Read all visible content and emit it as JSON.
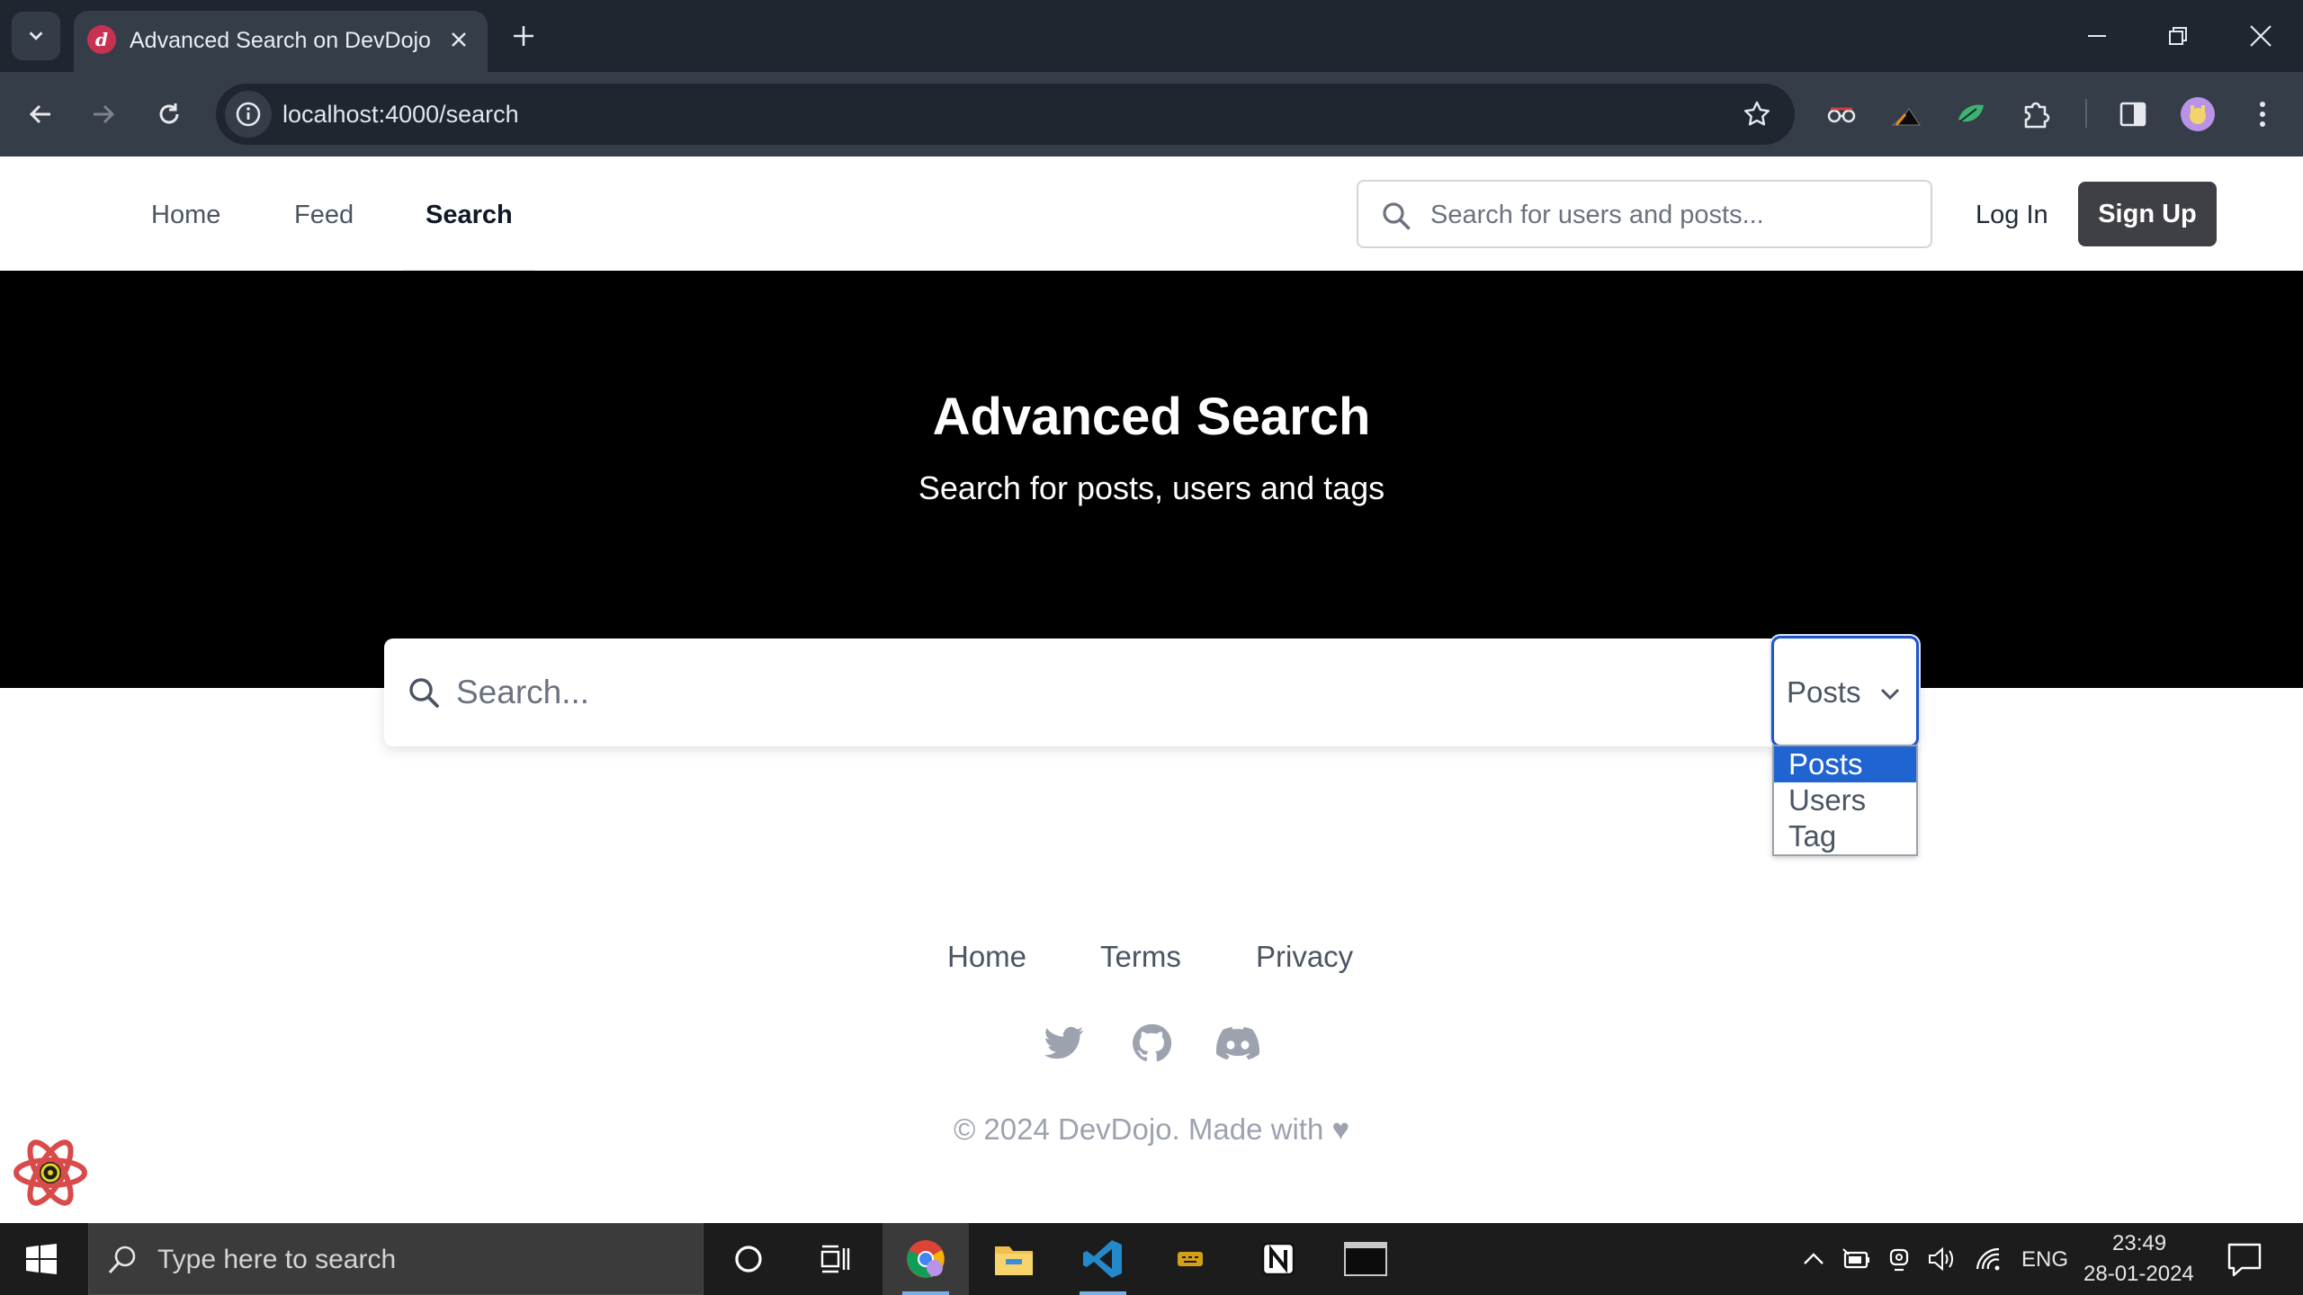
{
  "browser": {
    "tab_title": "Advanced Search on DevDojo",
    "favicon_letter": "d",
    "url": "localhost:4000/search"
  },
  "header": {
    "nav": [
      {
        "label": "Home",
        "active": false
      },
      {
        "label": "Feed",
        "active": false
      },
      {
        "label": "Search",
        "active": true
      }
    ],
    "search_placeholder": "Search for users and posts...",
    "login_label": "Log In",
    "signup_label": "Sign Up"
  },
  "hero": {
    "title": "Advanced Search",
    "subtitle": "Search for posts, users and tags"
  },
  "advanced_search": {
    "placeholder": "Search...",
    "type_selected": "Posts",
    "type_options": [
      "Posts",
      "Users",
      "Tag"
    ]
  },
  "footer": {
    "links": [
      "Home",
      "Terms",
      "Privacy"
    ],
    "social": [
      "twitter-icon",
      "github-icon",
      "discord-icon"
    ],
    "copyright": "© 2024 DevDojo. Made with",
    "heart": "♥"
  },
  "taskbar": {
    "search_placeholder": "Type here to search",
    "language": "ENG",
    "time": "23:49",
    "date": "28-01-2024"
  },
  "colors": {
    "chrome_dark": "#1f2630",
    "chrome_toolbar": "#353d48",
    "hero_bg": "#000000",
    "signup_bg": "#3f3f46",
    "select_focus": "#1f55c8",
    "option_selected": "#1f64d1"
  }
}
